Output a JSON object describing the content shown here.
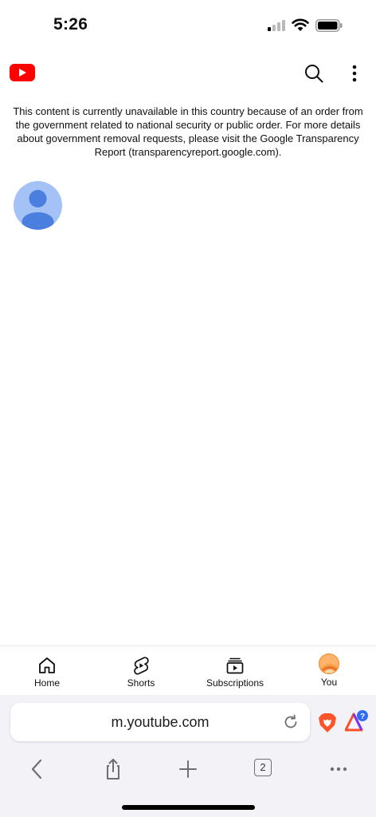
{
  "status_bar": {
    "time": "5:26"
  },
  "notice": {
    "text": "This content is currently unavailable in this country because of an order from the government related to national security or public order. For more details about government removal requests, please visit the Google Transparency Report (transparencyreport.google.com)."
  },
  "bottom_nav": {
    "items": [
      {
        "label": "Home",
        "icon": "home-icon"
      },
      {
        "label": "Shorts",
        "icon": "shorts-icon"
      },
      {
        "label": "Subscriptions",
        "icon": "subscriptions-icon"
      },
      {
        "label": "You",
        "icon": "avatar"
      }
    ]
  },
  "browser": {
    "url": "m.youtube.com",
    "tab_count": "2",
    "rewards_badge": "?"
  },
  "colors": {
    "youtube_red": "#ff0000",
    "avatar_bg": "#a4c2f6",
    "avatar_fg": "#4a7fe0",
    "brave_orange": "#fb542b",
    "rewards_blue": "#2f6cf2"
  }
}
